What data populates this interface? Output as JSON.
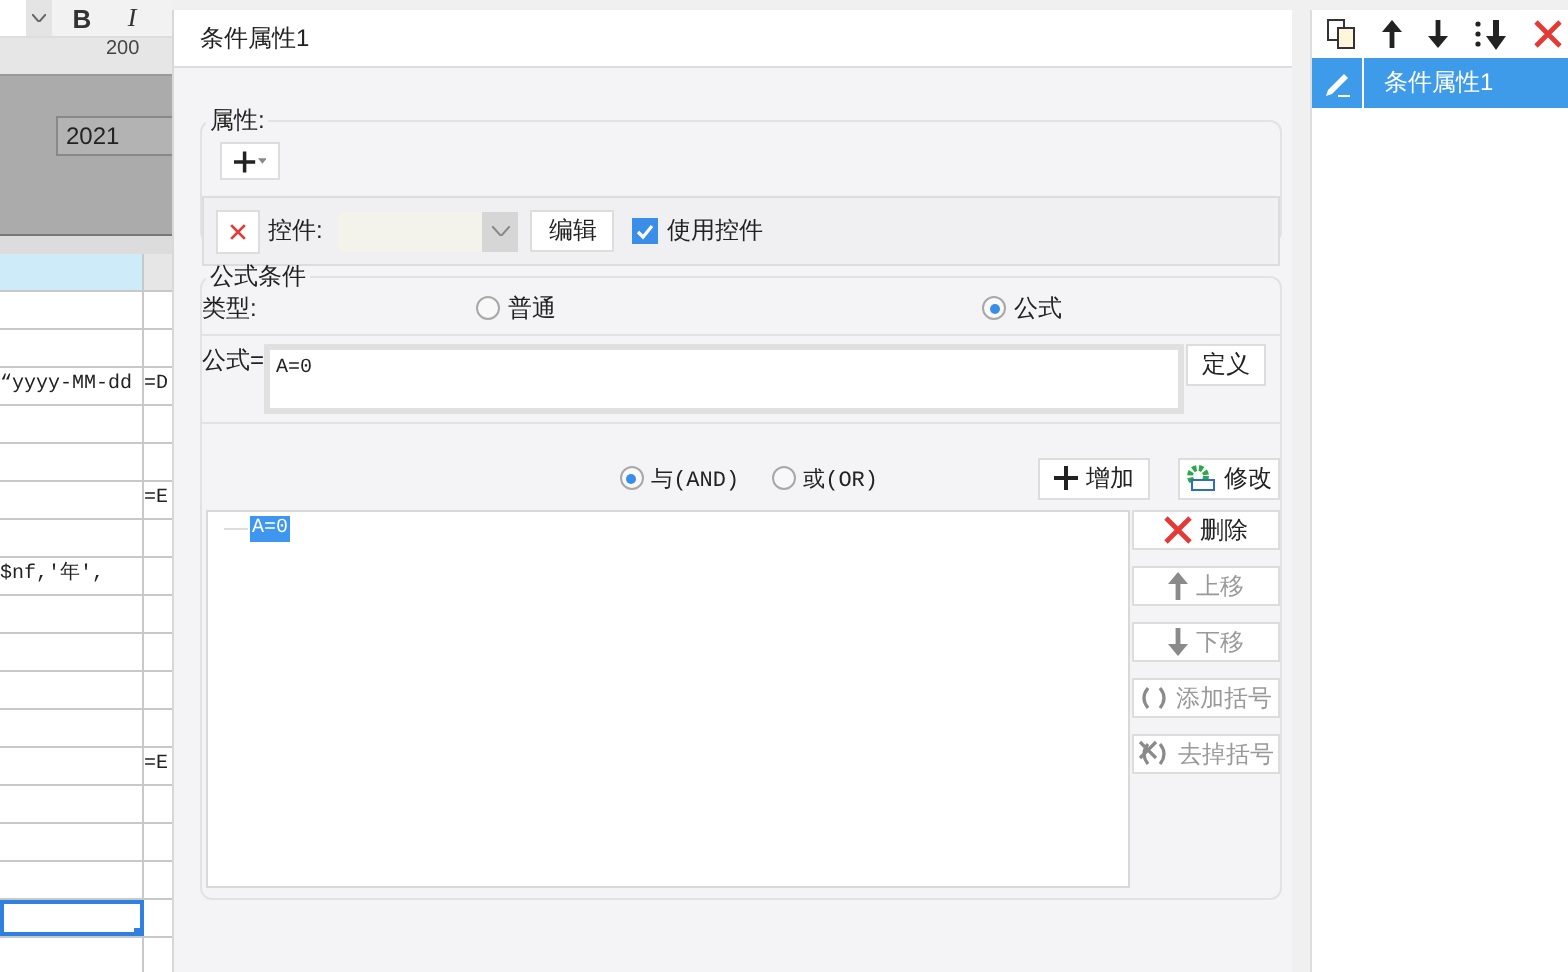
{
  "background_sheet": {
    "toolbar": [
      {
        "label": "B",
        "kind": "bold"
      },
      {
        "label": "I",
        "kind": "italic"
      }
    ],
    "ruler_label": "200",
    "year_field": "2021",
    "rows": [
      {
        "selected": false
      },
      {
        "selected": false
      },
      {
        "selected": false,
        "column_1": "“yyyy-MM-dd",
        "column_2": "=D"
      },
      {
        "selected": false
      },
      {
        "selected": false
      },
      {
        "selected": false,
        "column_2": "=E"
      },
      {
        "selected": false
      },
      {
        "selected": false,
        "column_1": "$nf,'年',"
      },
      {
        "selected": false
      },
      {
        "selected": false
      },
      {
        "selected": false
      },
      {
        "selected": false
      },
      {
        "selected": false,
        "column_2": "=E"
      },
      {
        "selected": false
      },
      {
        "selected": false
      },
      {
        "selected": false
      },
      {
        "selected": true
      },
      {
        "selected": false
      }
    ]
  },
  "dialog": {
    "title": "条件属性1",
    "properties": {
      "legend": "属性:",
      "control_label": "控件:",
      "edit_button": "编辑",
      "use_control": {
        "label": "使用控件",
        "checked": true
      }
    },
    "formula_condition": {
      "legend": "公式条件",
      "type_label": "类型:",
      "type_options": [
        {
          "label": "普通",
          "selected": false
        },
        {
          "label": "公式",
          "selected": true
        }
      ],
      "formula_label": "公式=",
      "formula_value": "A=0",
      "define_button": "定义",
      "logic_options": [
        {
          "label": "与(AND)",
          "selected": true
        },
        {
          "label": "或(OR)",
          "selected": false
        }
      ],
      "add_button": "增加",
      "modify_button": "修改",
      "conditions": [
        {
          "label": "A=0",
          "selected": true
        }
      ],
      "actions": [
        {
          "label": "删除",
          "kind": "delete",
          "disabled": false
        },
        {
          "label": "上移",
          "kind": "up",
          "disabled": true
        },
        {
          "label": "下移",
          "kind": "down",
          "disabled": true
        },
        {
          "label": "添加括号",
          "kind": "add_parens",
          "disabled": true
        },
        {
          "label": "去掉括号",
          "kind": "remove_parens",
          "disabled": true
        }
      ]
    }
  },
  "side_panel": {
    "items": [
      {
        "label": "条件属性1",
        "selected": true
      }
    ]
  }
}
